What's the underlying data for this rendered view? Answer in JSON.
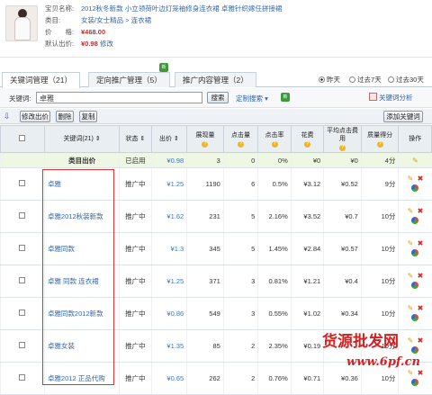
{
  "product": {
    "name_label": "宝贝名称:",
    "name_value": "2012秋冬新款 小立领荷叶边灯笼袖修身连衣裙 卓雅针织嫁任拼接裙",
    "category_label": "类目:",
    "category_value": "女装/女士精品 > 连衣裙",
    "price_label": "价　　格:",
    "price_value": "¥468.00",
    "default_bid_label": "默认出价:",
    "default_bid_value": "¥0.98",
    "edit_link": "修改"
  },
  "tabs": [
    {
      "label": "关键词管理（21）",
      "active": true
    },
    {
      "label": "定向推广管理（5）",
      "active": false,
      "badge": "新"
    },
    {
      "label": "推广内容管理（2）",
      "active": false
    }
  ],
  "range": [
    {
      "label": "昨天",
      "selected": true
    },
    {
      "label": "过去7天",
      "selected": false
    },
    {
      "label": "过去30天",
      "selected": false
    }
  ],
  "search": {
    "label": "关键词:",
    "value": "卓雅",
    "button": "搜索",
    "custom_search": "定制搜索",
    "custom_badge": "新",
    "analysis_link": "关键词分析"
  },
  "toolbar": {
    "edit_bid": "修改出价",
    "delete": "删除",
    "copy": "复制",
    "add_keyword": "添加关键词"
  },
  "columns": [
    "关键词(21)",
    "状态",
    "出价",
    "展现量",
    "点击量",
    "点击率",
    "花费",
    "平均点击费用",
    "质量得分",
    "操作"
  ],
  "category_row": {
    "keyword": "类目出价",
    "status": "已启用",
    "bid": "¥0.98",
    "impressions": "3",
    "clicks": "0",
    "ctr": "0%",
    "cost": "¥0",
    "avg_cpc": "¥0",
    "quality": "4分"
  },
  "rows": [
    {
      "keyword": "卓雅",
      "status": "推广中",
      "bid": "¥1.25",
      "impressions": "1190",
      "clicks": "6",
      "ctr": "0.5%",
      "cost": "¥3.12",
      "avg_cpc": "¥0.52",
      "quality": "9分"
    },
    {
      "keyword": "卓雅2012秋装新款",
      "status": "推广中",
      "bid": "¥1.62",
      "impressions": "231",
      "clicks": "5",
      "ctr": "2.16%",
      "cost": "¥3.52",
      "avg_cpc": "¥0.7",
      "quality": "10分"
    },
    {
      "keyword": "卓雅同款",
      "status": "推广中",
      "bid": "¥1.3",
      "impressions": "345",
      "clicks": "5",
      "ctr": "1.45%",
      "cost": "¥2.84",
      "avg_cpc": "¥0.57",
      "quality": "10分"
    },
    {
      "keyword": "卓雅 同款 连衣裙",
      "status": "推广中",
      "bid": "¥1.25",
      "impressions": "371",
      "clicks": "3",
      "ctr": "0.81%",
      "cost": "¥1.21",
      "avg_cpc": "¥0.4",
      "quality": "10分"
    },
    {
      "keyword": "卓雅同款2012新款",
      "status": "推广中",
      "bid": "¥0.86",
      "impressions": "549",
      "clicks": "3",
      "ctr": "0.55%",
      "cost": "¥1.02",
      "avg_cpc": "¥0.34",
      "quality": "10分"
    },
    {
      "keyword": "卓雅女装",
      "status": "推广中",
      "bid": "¥1.35",
      "impressions": "85",
      "clicks": "2",
      "ctr": "2.35%",
      "cost": "¥0.19",
      "avg_cpc": "",
      "quality": "10分"
    },
    {
      "keyword": "卓雅2012 正品代购",
      "status": "推广中",
      "bid": "¥0.65",
      "impressions": "262",
      "clicks": "2",
      "ctr": "0.76%",
      "cost": "¥0.71",
      "avg_cpc": "¥0.36",
      "quality": "10分"
    }
  ],
  "watermark": {
    "line1": "货源批发网",
    "line2": "www.6pf.cn"
  },
  "colors": {
    "accent": "#3366aa",
    "price": "#dd2222",
    "category_row_bg": "#eef7e4",
    "highlight_box": "#dd3333"
  }
}
